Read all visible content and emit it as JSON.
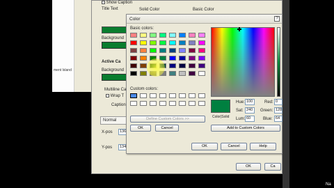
{
  "background_window": {
    "show_caption": "Show Caption",
    "title_text_label": "Title Text",
    "solid_color": "Solid Color",
    "basic_color": "Basic Color",
    "background_label": "Background",
    "active_label": "Active Ca",
    "multiline": "Multiline Ca",
    "wrap": "Wrap T",
    "caption": "Caption",
    "normal": "Normal",
    "xpos_label": "X-pos",
    "xpos_value": "136",
    "ypos_label": "Y-pos",
    "ypos_value": "134",
    "ok_label": "OK",
    "cancel_label": "Ca"
  },
  "left_panel": {
    "label": "ment Island"
  },
  "color_dialog": {
    "title": "Color",
    "basic_colors_label": "Basic colors:",
    "custom_colors_label": "Custom colors:",
    "define_button": "Define Custom Colors >>",
    "ok_label": "OK",
    "cancel_label": "Cancel",
    "color_solid_label": "Color|Solid",
    "hue_label": "Hue:",
    "hue_value": "100",
    "sat_label": "Sat:",
    "sat_value": "240",
    "lum_label": "Lum:",
    "lum_value": "60",
    "red_label": "Red:",
    "red_value": "0",
    "green_label": "Green:",
    "green_value": "128",
    "blue_label": "Blue:",
    "blue_value": "64",
    "add_custom_button": "Add to Custom Colors",
    "selected_color": "#008040",
    "basic_colors": [
      "#ff8080",
      "#ffff80",
      "#80ff80",
      "#00ff80",
      "#80ffff",
      "#0080ff",
      "#ff80c0",
      "#ff80ff",
      "#ff0000",
      "#ffff00",
      "#80ff00",
      "#00ff40",
      "#00ffff",
      "#0080c0",
      "#8080c0",
      "#ff00ff",
      "#804040",
      "#ff8040",
      "#00ff00",
      "#008080",
      "#004080",
      "#8080ff",
      "#800040",
      "#ff0080",
      "#800000",
      "#ff8000",
      "#008000",
      "#008040",
      "#0000ff",
      "#0000a0",
      "#800080",
      "#8000ff",
      "#400000",
      "#804000",
      "#004000",
      "#004040",
      "#000080",
      "#000040",
      "#400040",
      "#400080",
      "#000000",
      "#808000",
      "#808040",
      "#808080",
      "#408080",
      "#c0c0c0",
      "#400040",
      "#ffffff"
    ]
  },
  "bottom_dialog_buttons": {
    "ok_label": "OK",
    "cancel_label": "Cancel",
    "help_label": "Help"
  },
  "corner_text": "Na"
}
